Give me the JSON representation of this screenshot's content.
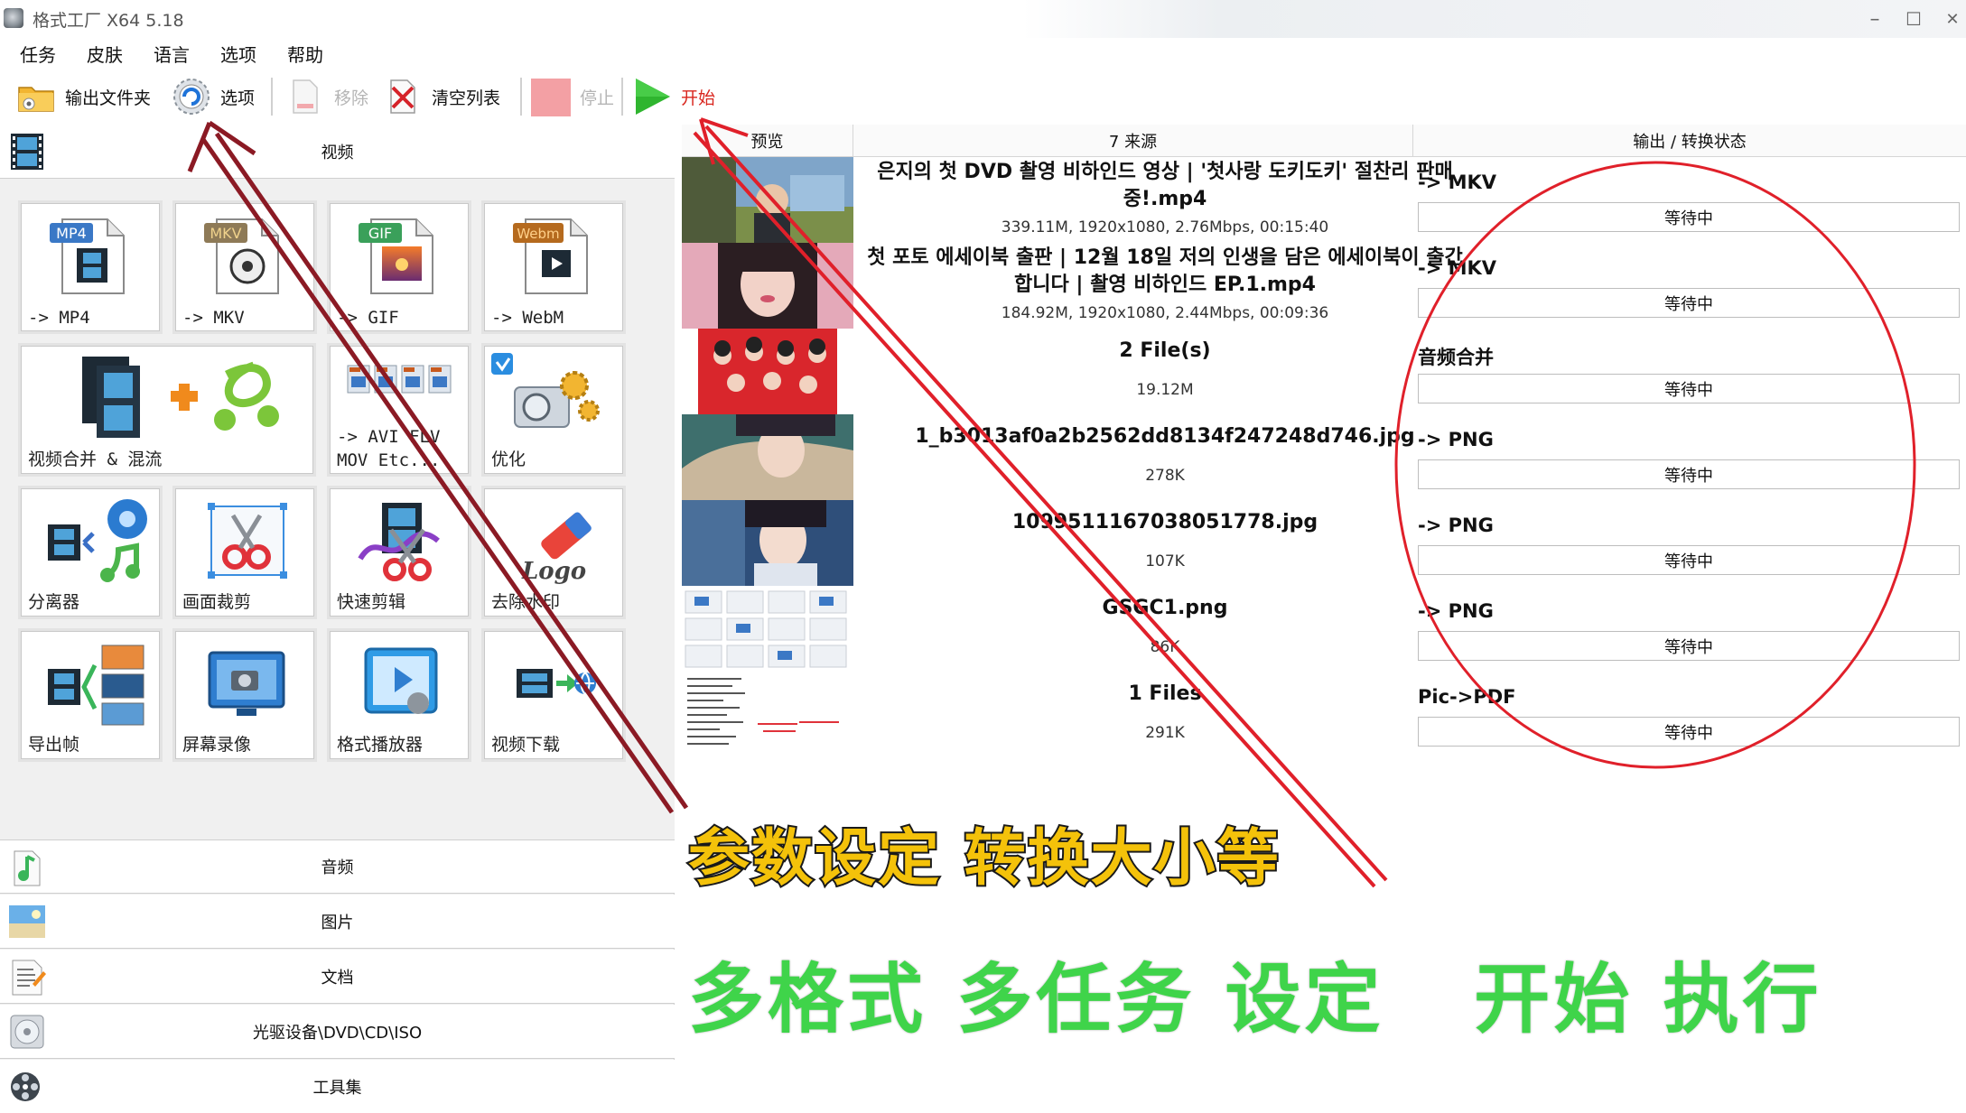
{
  "window": {
    "title": "格式工厂 X64 5.18",
    "controls": [
      "–",
      "☐",
      "✕"
    ]
  },
  "menu": [
    "任务",
    "皮肤",
    "语言",
    "选项",
    "帮助"
  ],
  "toolbar": {
    "output_folder": "输出文件夹",
    "options": "选项",
    "remove": "移除",
    "clear_list": "清空列表",
    "stop": "停止",
    "start": "开始"
  },
  "categories": {
    "video": "视频",
    "audio": "音频",
    "image": "图片",
    "document": "文档",
    "optical": "光驱设备\\DVD\\CD\\ISO",
    "tools": "工具集"
  },
  "tiles": [
    {
      "label": "-> MP4",
      "badge": "MP4",
      "icon": "mp4-file-icon"
    },
    {
      "label": "-> MKV",
      "badge": "MKV",
      "icon": "mkv-file-icon"
    },
    {
      "label": "-> GIF",
      "badge": "GIF",
      "icon": "gif-file-icon"
    },
    {
      "label": "-> WebM",
      "badge": "Webm",
      "icon": "webm-file-icon"
    },
    {
      "label": "视频合并 & 混流",
      "icon": "video-merge-icon"
    },
    {
      "label": "-> AVI FLV",
      "label2": "MOV Etc...",
      "icon": "video-formats-icon"
    },
    {
      "label": "优化",
      "icon": "optimize-icon"
    },
    {
      "label": "分离器",
      "icon": "splitter-icon"
    },
    {
      "label": "画面裁剪",
      "icon": "crop-icon"
    },
    {
      "label": "快速剪辑",
      "icon": "quick-clip-icon"
    },
    {
      "label": "去除水印",
      "icon": "remove-watermark-icon",
      "logo_text": "Logo"
    },
    {
      "label": "导出帧",
      "icon": "export-frames-icon"
    },
    {
      "label": "屏幕录像",
      "icon": "screen-record-icon"
    },
    {
      "label": "格式播放器",
      "icon": "player-icon"
    },
    {
      "label": "视频下载",
      "icon": "video-download-icon"
    }
  ],
  "list": {
    "headers": {
      "preview": "预览",
      "source": "7 来源",
      "output": "输出 / 转换状态"
    },
    "rows": [
      {
        "title": "은지의 첫 DVD 촬영 비하인드 영상 | '첫사랑 도키도키' 절찬리 판매중!.mp4",
        "meta": "339.11M, 1920x1080, 2.76Mbps, 00:15:40",
        "output": "-> MKV",
        "status": "等待中"
      },
      {
        "title": "첫 포토 에세이북 출판 | 12월 18일 저의 인생을 담은 에세이북이 출간합니다 | 촬영 비하인드 EP.1.mp4",
        "meta": "184.92M, 1920x1080, 2.44Mbps, 00:09:36",
        "output": "-> MKV",
        "status": "等待中"
      },
      {
        "title": "2 File(s)",
        "meta": "19.12M",
        "output": "音频合并",
        "status": "等待中"
      },
      {
        "title": "1_b3013af0a2b2562dd8134f247248d746.jpg",
        "meta": "278K",
        "output": "-> PNG",
        "status": "等待中"
      },
      {
        "title": "1099511167038051778.jpg",
        "meta": "107K",
        "output": "-> PNG",
        "status": "等待中"
      },
      {
        "title": "GSGC1.png",
        "meta": "86K",
        "output": "-> PNG",
        "status": "等待中"
      },
      {
        "title": "1 Files",
        "meta": "291K",
        "output": "Pic->PDF",
        "status": "等待中"
      }
    ]
  },
  "annotations": {
    "caption1": "参数设定 转换大小等",
    "caption2": "多格式 多任务 设定   开始 执行",
    "arrow_color": "#8b1a24",
    "arrow2_color": "#e0202a",
    "circle_color": "#e0202a"
  },
  "colors": {
    "start_green": "#2fb52f",
    "stop_pink": "#f3a0a4",
    "caption1_fill": "#f4c20a",
    "caption2_fill": "#3fd44a"
  }
}
